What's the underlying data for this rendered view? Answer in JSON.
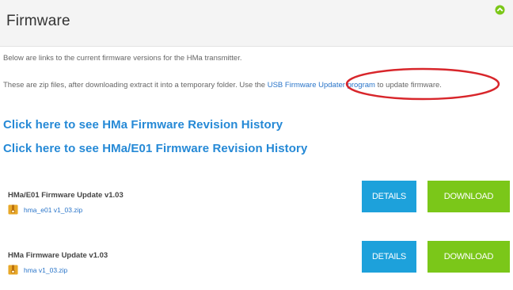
{
  "header": {
    "title": "Firmware",
    "collapse_icon": "up-arrow-circle-icon",
    "collapse_color": "#7bc719"
  },
  "intro": {
    "line1": "Below are links to the current firmware versions for the HMa transmitter.",
    "line2_before": "These are zip files, after downloading extract it into a temporary folder. Use the ",
    "line2_link": "USB Firmware Updater program",
    "line2_after": " to update firmware."
  },
  "links": {
    "hma_history": "Click here to see HMa Firmware Revision History",
    "e01_history": "Click here to see HMa/E01 Firmware Revision History"
  },
  "updates": [
    {
      "title": "HMa/E01 Firmware Update v1.03",
      "file": "hma_e01 v1_03.zip",
      "details_label": "DETAILS",
      "download_label": "DOWNLOAD"
    },
    {
      "title": "HMa Firmware Update v1.03",
      "file": "hma v1_03.zip",
      "details_label": "DETAILS",
      "download_label": "DOWNLOAD"
    }
  ],
  "icons": {
    "zip": "zip-file-icon"
  },
  "colors": {
    "details": "#1da1db",
    "download": "#7bc719",
    "link": "#2589d6",
    "annotation_circle": "#d8262b"
  }
}
